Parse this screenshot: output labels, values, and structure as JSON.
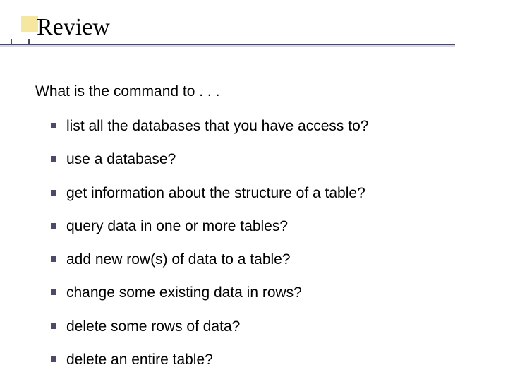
{
  "title": "Review",
  "intro": "What is the command to . . .",
  "bullets": [
    "list all the databases that you have access to?",
    "use a database?",
    "get information about the structure of a table?",
    "query data in one or more tables?",
    "add new row(s) of data to a table?",
    "change some existing data in rows?",
    "delete some rows of data?",
    "delete an entire table?"
  ]
}
